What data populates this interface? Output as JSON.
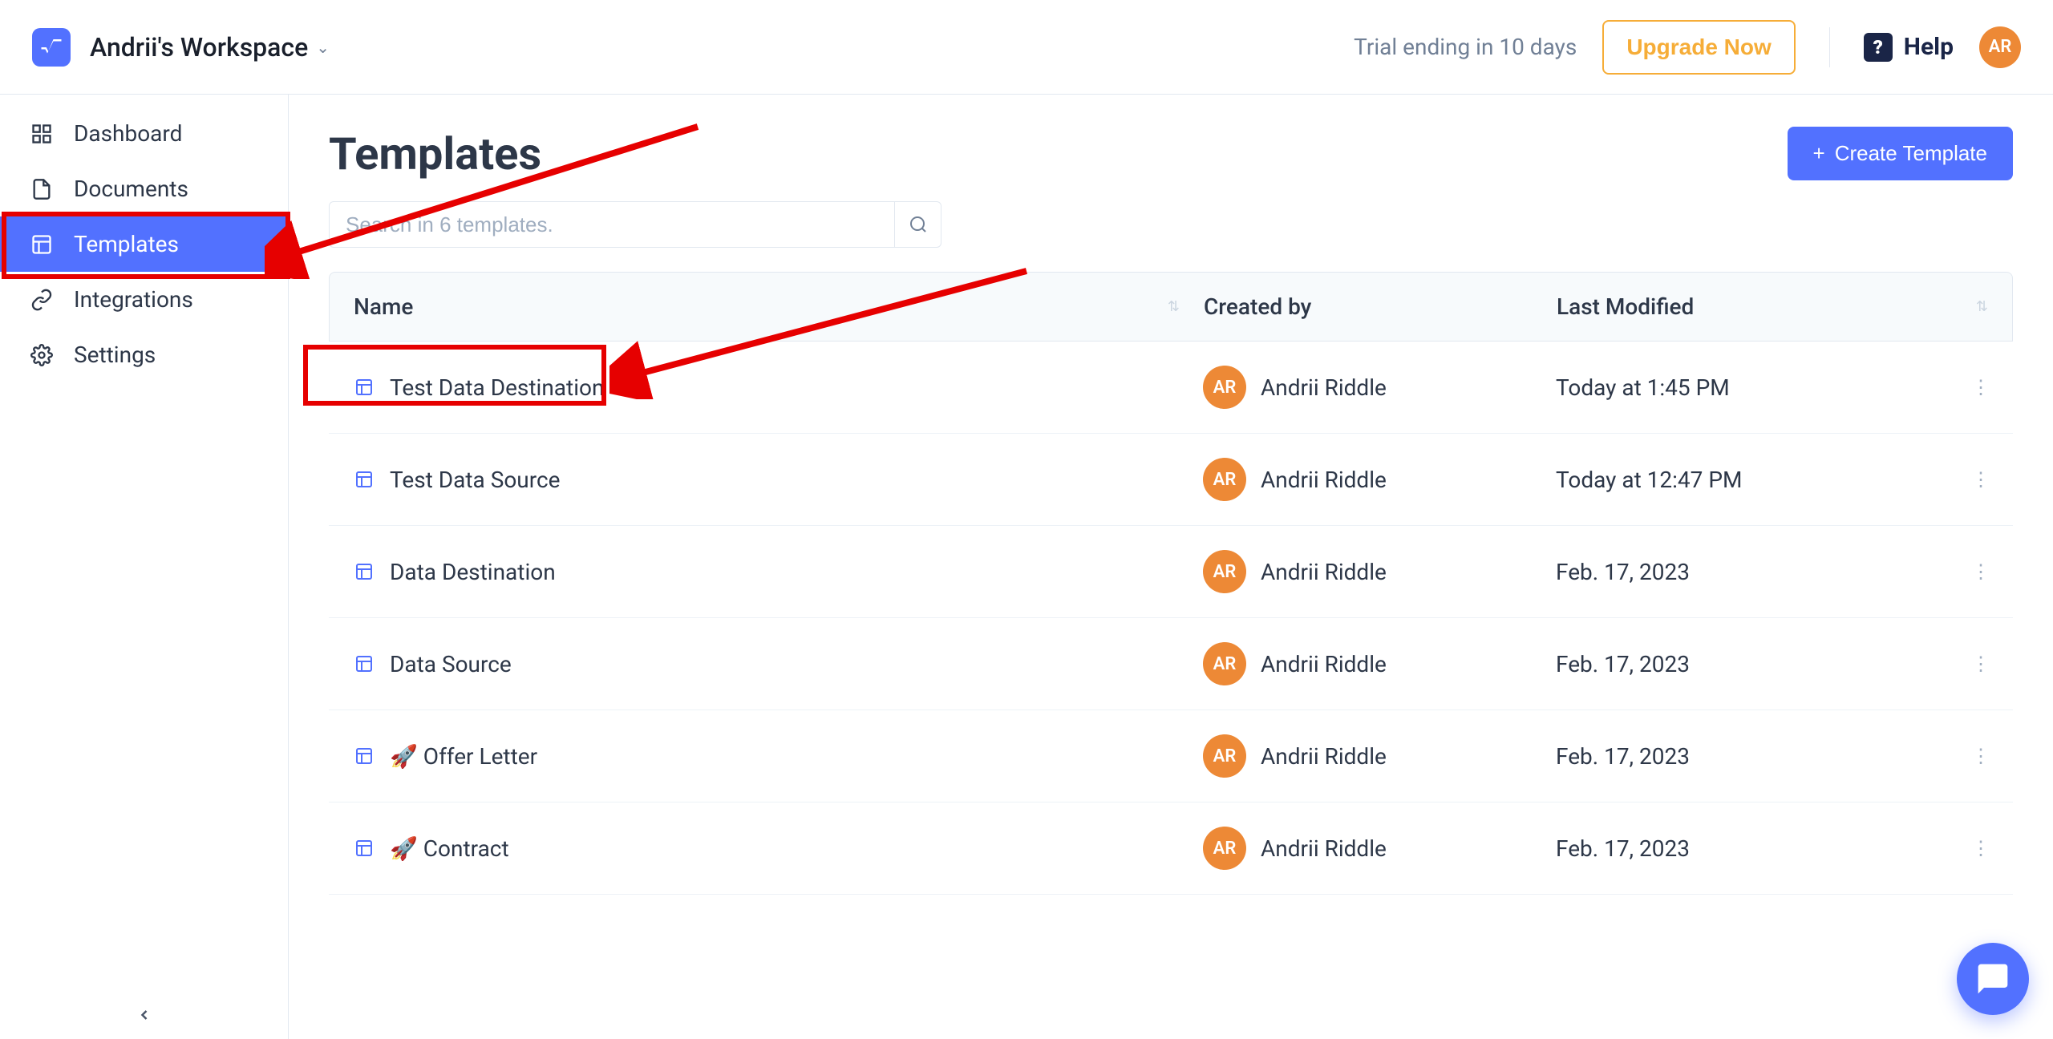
{
  "header": {
    "workspace_name": "Andrii's Workspace",
    "trial_text": "Trial ending in 10 days",
    "upgrade_label": "Upgrade Now",
    "help_label": "Help",
    "avatar_initials": "AR"
  },
  "sidebar": {
    "items": [
      {
        "label": "Dashboard"
      },
      {
        "label": "Documents"
      },
      {
        "label": "Templates"
      },
      {
        "label": "Integrations"
      },
      {
        "label": "Settings"
      }
    ]
  },
  "main": {
    "title": "Templates",
    "create_label": "Create Template",
    "search_placeholder": "Search in 6 templates.",
    "columns": {
      "name": "Name",
      "created_by": "Created by",
      "last_modified": "Last Modified"
    },
    "rows": [
      {
        "name": "Test Data Destination",
        "creator_initials": "AR",
        "creator_name": "Andrii Riddle",
        "modified": "Today at 1:45 PM",
        "emoji": ""
      },
      {
        "name": "Test Data Source",
        "creator_initials": "AR",
        "creator_name": "Andrii Riddle",
        "modified": "Today at 12:47 PM",
        "emoji": ""
      },
      {
        "name": "Data Destination",
        "creator_initials": "AR",
        "creator_name": "Andrii Riddle",
        "modified": "Feb. 17, 2023",
        "emoji": ""
      },
      {
        "name": "Data Source",
        "creator_initials": "AR",
        "creator_name": "Andrii Riddle",
        "modified": "Feb. 17, 2023",
        "emoji": ""
      },
      {
        "name": "Offer Letter",
        "creator_initials": "AR",
        "creator_name": "Andrii Riddle",
        "modified": "Feb. 17, 2023",
        "emoji": "🚀"
      },
      {
        "name": "Contract",
        "creator_initials": "AR",
        "creator_name": "Andrii Riddle",
        "modified": "Feb. 17, 2023",
        "emoji": "🚀"
      }
    ]
  }
}
